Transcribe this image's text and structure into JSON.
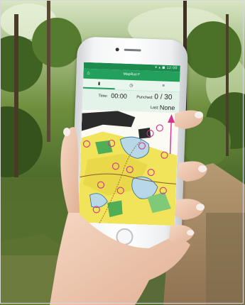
{
  "app": {
    "title": "MapRun F",
    "status_icons": "▾ ▴ ◼ 12:00"
  },
  "tabs": [
    {
      "icon": "map-icon",
      "glyph": "▮"
    },
    {
      "icon": "clock-icon",
      "glyph": "◷"
    },
    {
      "icon": "settings-icon",
      "glyph": "≡"
    }
  ],
  "timer": {
    "time_label": "Time:",
    "time_value": "00:00",
    "punched_label": "Punched:",
    "punched_value": "0 / 30",
    "last_label": "Last:",
    "last_value": "None"
  },
  "colors": {
    "app_bar": "#23a05c",
    "status_bar": "#1d8a4e",
    "control_marker": "#d4338f",
    "north_arrow": "#d4338f"
  }
}
